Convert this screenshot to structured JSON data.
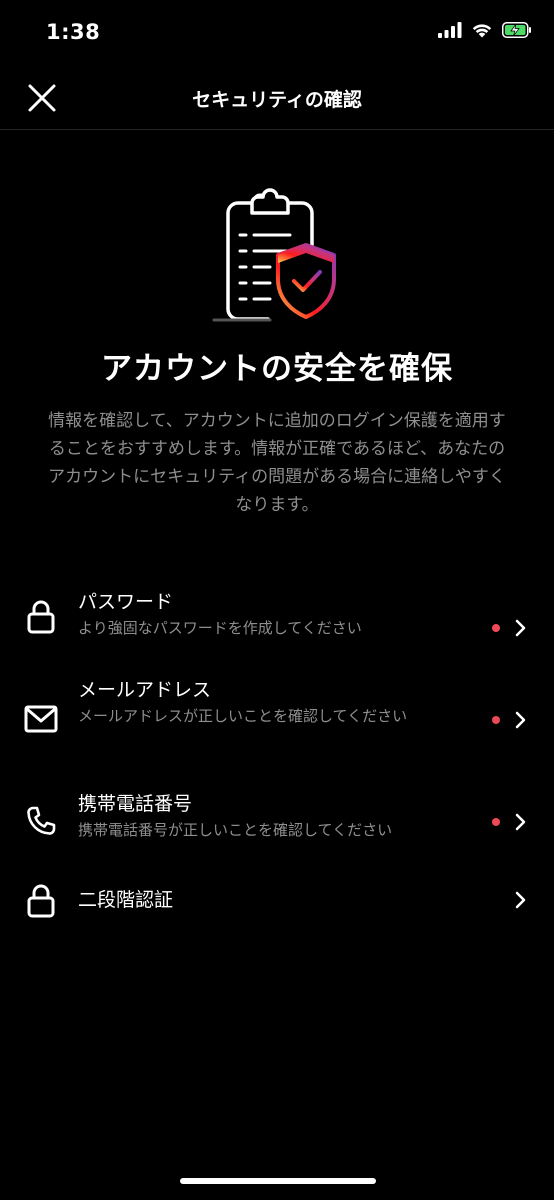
{
  "status_bar": {
    "time": "1:38"
  },
  "nav": {
    "title": "セキュリティの確認",
    "close_icon": "close-icon"
  },
  "hero": {
    "illustration": "clipboard-shield-check-icon",
    "title": "アカウントの安全を確保",
    "description": "情報を確認して、アカウントに追加のログイン保護を適用することをおすすめします。情報が正確であるほど、あなたのアカウントにセキュリティの問題がある場合に連絡しやすくなります。"
  },
  "items": [
    {
      "icon": "lock-icon",
      "label": "パスワード",
      "sub": "より強固なパスワードを作成してください",
      "has_alert": true
    },
    {
      "icon": "mail-icon",
      "label": "メールアドレス",
      "sub": "メールアドレスが正しいことを確認してください",
      "has_alert": true
    },
    {
      "icon": "phone-icon",
      "label": "携帯電話番号",
      "sub": "携帯電話番号が正しいことを確認してください",
      "has_alert": true
    },
    {
      "icon": "lock-icon",
      "label": "二段階認証",
      "sub": "",
      "has_alert": false
    }
  ],
  "colors": {
    "background": "#000000",
    "alert_dot": "#ed4956",
    "secondary_text": "#8e8e8e",
    "battery_charging": "#4cd964"
  }
}
